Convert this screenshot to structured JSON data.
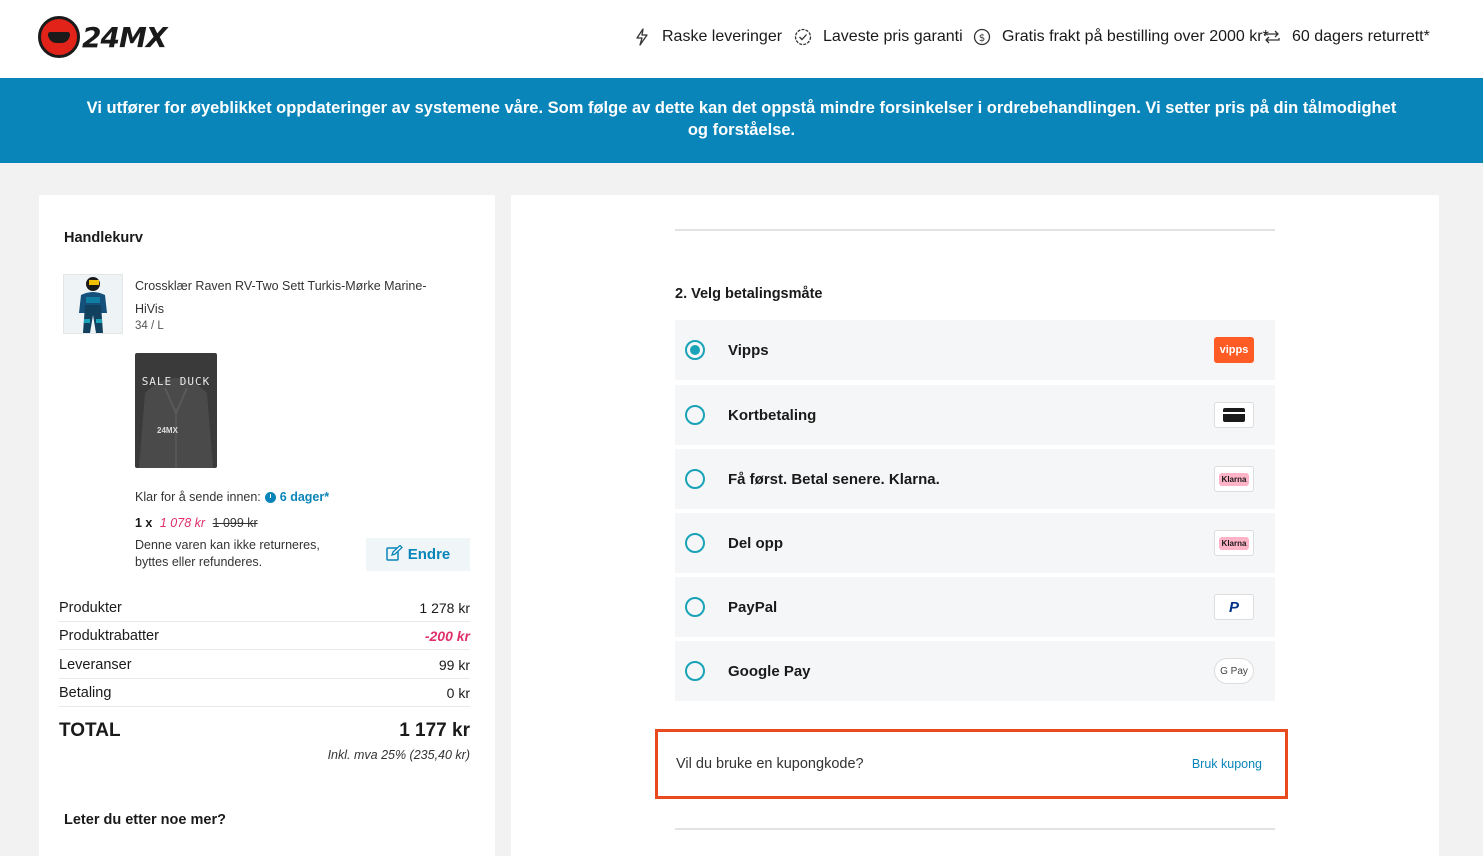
{
  "header": {
    "logo_text": "24MX",
    "usps": [
      {
        "icon": "lightning-icon",
        "label": "Raske leveringer"
      },
      {
        "icon": "check-badge-icon",
        "label": "Laveste pris garanti"
      },
      {
        "icon": "dollar-circle-icon",
        "label": "Gratis frakt på bestilling over 2000 kr*"
      },
      {
        "icon": "return-arrows-icon",
        "label": "60 dagers returrett*"
      }
    ]
  },
  "banner": {
    "text": "Vi utfører for øyeblikket oppdateringer av systemene våre. Som følge av dette kan det oppstå mindre forsinkelser i ordrebehandlingen. Vi setter pris på din tålmodighet og forståelse."
  },
  "cart": {
    "title": "Handlekurv",
    "product": {
      "name": "Crossklær Raven RV-Two Sett Turkis-Mørke Marine-HiVis",
      "size": "34 / L",
      "bonus_image_text": "SALE DUCK",
      "bonus_image_logo": "24MX",
      "ship_label": "Klar for å sende innen:",
      "ship_days": "6 dager*",
      "qty": "1 x",
      "sale_price": "1 078 kr",
      "old_price": "1 099 kr",
      "no_return": "Denne varen kan ikke returneres, byttes eller refunderes.",
      "edit_label": "Endre"
    },
    "summary": [
      {
        "label": "Produkter",
        "value": "1 278 kr"
      },
      {
        "label": "Produktrabatter",
        "value": "-200 kr"
      },
      {
        "label": "Leveranser",
        "value": "99 kr"
      },
      {
        "label": "Betaling",
        "value": "0 kr"
      }
    ],
    "total_label": "TOTAL",
    "total_value": "1 177 kr",
    "vat": "Inkl. mva 25% (235,40 kr)",
    "more": "Leter du etter noe mer?"
  },
  "payment": {
    "title": "2. Velg betalingsmåte",
    "options": [
      {
        "label": "Vipps",
        "logo": "vipps",
        "selected": true
      },
      {
        "label": "Kortbetaling",
        "logo": "card-icon",
        "selected": false
      },
      {
        "label": "Få først. Betal senere. Klarna.",
        "logo": "Klarna",
        "selected": false
      },
      {
        "label": "Del opp",
        "logo": "Klarna",
        "selected": false
      },
      {
        "label": "PayPal",
        "logo": "P",
        "selected": false
      },
      {
        "label": "Google Pay",
        "logo": "G Pay",
        "selected": false
      }
    ],
    "coupon_question": "Vil du bruke en kupongkode?",
    "coupon_link": "Bruk kupong"
  },
  "colors": {
    "accent": "#0a85b9",
    "radio": "#1aa3b8",
    "discount": "#e0306a",
    "highlight": "#e8491d",
    "vipps": "#ff5b24"
  }
}
